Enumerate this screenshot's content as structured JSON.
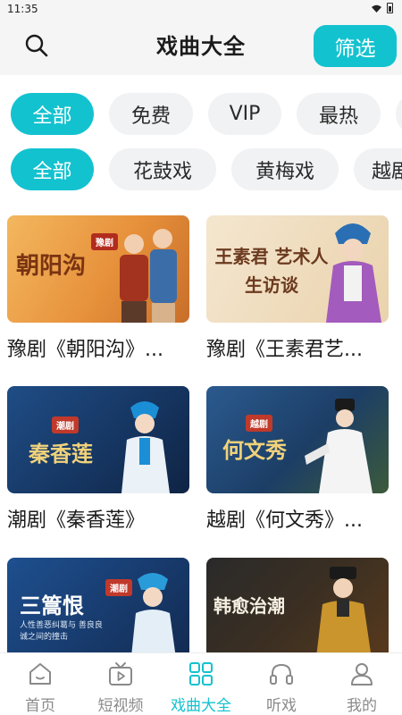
{
  "status_bar": {
    "time": "11:35"
  },
  "header": {
    "title": "戏曲大全",
    "filter_label": "筛选"
  },
  "filter_row_1": [
    "全部",
    "免费",
    "VIP",
    "最热",
    ""
  ],
  "filter_row_2": [
    "全部",
    "花鼓戏",
    "黄梅戏",
    "越剧"
  ],
  "items": [
    {
      "title": "豫剧《朝阳沟》...",
      "thumb_text": "朝阳沟",
      "thumb_tag": "豫剧"
    },
    {
      "title": "豫剧《王素君艺...",
      "thumb_text": "王素君 艺术人生访谈",
      "thumb_tag": ""
    },
    {
      "title": "潮剧《秦香莲》",
      "thumb_text": "秦香莲",
      "thumb_tag": "潮剧"
    },
    {
      "title": "越剧《何文秀》...",
      "thumb_text": "何文秀",
      "thumb_tag": "越剧"
    },
    {
      "title": "",
      "thumb_text": "三篙恨",
      "thumb_tag": "潮剧",
      "thumb_sub": "人性善恶纠葛与 善良良诚之间的撞击"
    },
    {
      "title": "",
      "thumb_text": "韩愈治潮",
      "thumb_tag": ""
    }
  ],
  "bottom_nav": [
    {
      "label": "首页",
      "icon": "home-icon"
    },
    {
      "label": "短视频",
      "icon": "tv-icon"
    },
    {
      "label": "戏曲大全",
      "icon": "grid-icon",
      "active": true
    },
    {
      "label": "听戏",
      "icon": "headphones-icon"
    },
    {
      "label": "我的",
      "icon": "user-icon"
    }
  ],
  "colors": {
    "accent": "#13c2cf",
    "chip_bg": "#f1f2f4",
    "nav_inactive": "#8a8a8a"
  }
}
